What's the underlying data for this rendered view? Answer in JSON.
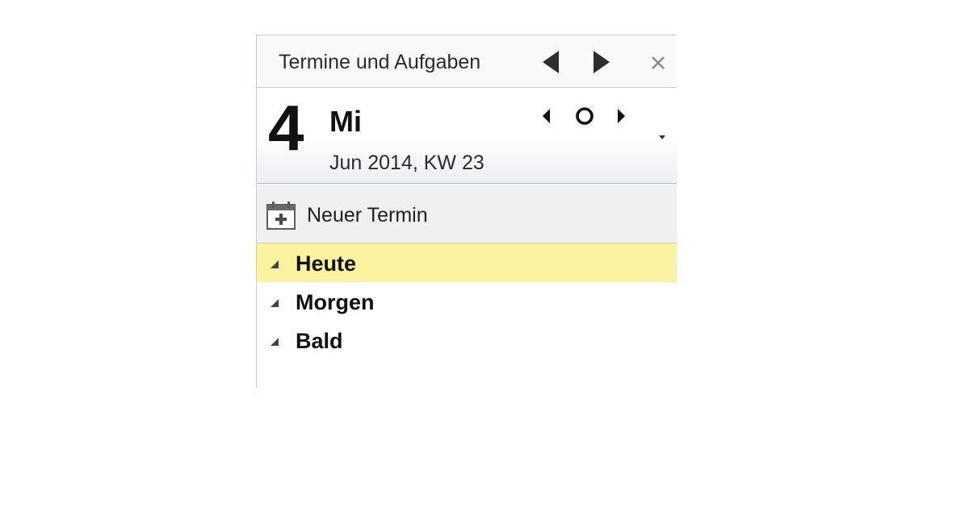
{
  "pane": {
    "title": "Termine und Aufgaben",
    "prev_icon": "triangle-left-icon",
    "next_icon": "triangle-right-icon",
    "close_icon": "close-icon"
  },
  "date": {
    "day": "4",
    "weekday": "Mi",
    "month_week": "Jun 2014, KW 23"
  },
  "toolbar": {
    "new_appointment_label": "Neuer Termin",
    "new_appointment_icon": "calendar-add-icon"
  },
  "groups": [
    {
      "label": "Heute",
      "highlighted": true
    },
    {
      "label": "Morgen",
      "highlighted": false
    },
    {
      "label": "Bald",
      "highlighted": false
    }
  ],
  "colors": {
    "highlight": "#fcf3a0",
    "icon": "#2e2e2e",
    "border": "#c9cdd3"
  }
}
